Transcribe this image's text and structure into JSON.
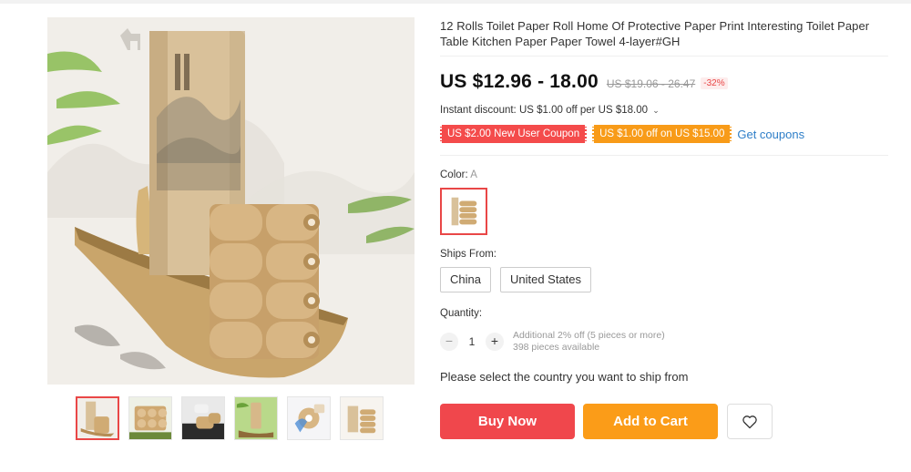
{
  "product": {
    "title": "12 Rolls Toilet Paper Roll Home Of Protective Paper Print Interesting Toilet Paper Table Kitchen Paper Paper Towel 4-layer#GH"
  },
  "price": {
    "current": "US $12.96 - 18.00",
    "original": "US $19.06 - 26.47",
    "discount": "-32%"
  },
  "instant_discount": "Instant discount: US $1.00 off per US $18.00",
  "coupons": [
    {
      "label": "US $2.00 New User Coupon",
      "color": "#f44b4b"
    },
    {
      "label": "US $1.00 off on US $15.00",
      "color": "#f89b18"
    }
  ],
  "get_coupons_label": "Get coupons",
  "color": {
    "label": "Color:",
    "value": "A"
  },
  "ships_from": {
    "label": "Ships From:",
    "options": [
      "China",
      "United States"
    ]
  },
  "quantity": {
    "label": "Quantity:",
    "value": "1",
    "minus": "−",
    "plus": "+",
    "note_line1": "Additional 2% off (5 pieces or more)",
    "note_line2": "398 pieces available"
  },
  "ship_message": "Please select the country you want to ship from",
  "buttons": {
    "buy_now": "Buy Now",
    "add_to_cart": "Add to Cart"
  },
  "icons": {
    "wishlist": "heart-icon",
    "dropdown": "chevron-down-icon"
  },
  "colors": {
    "accent_red": "#f0474c",
    "accent_orange": "#fb9c18",
    "link_blue": "#2e7ec8"
  }
}
